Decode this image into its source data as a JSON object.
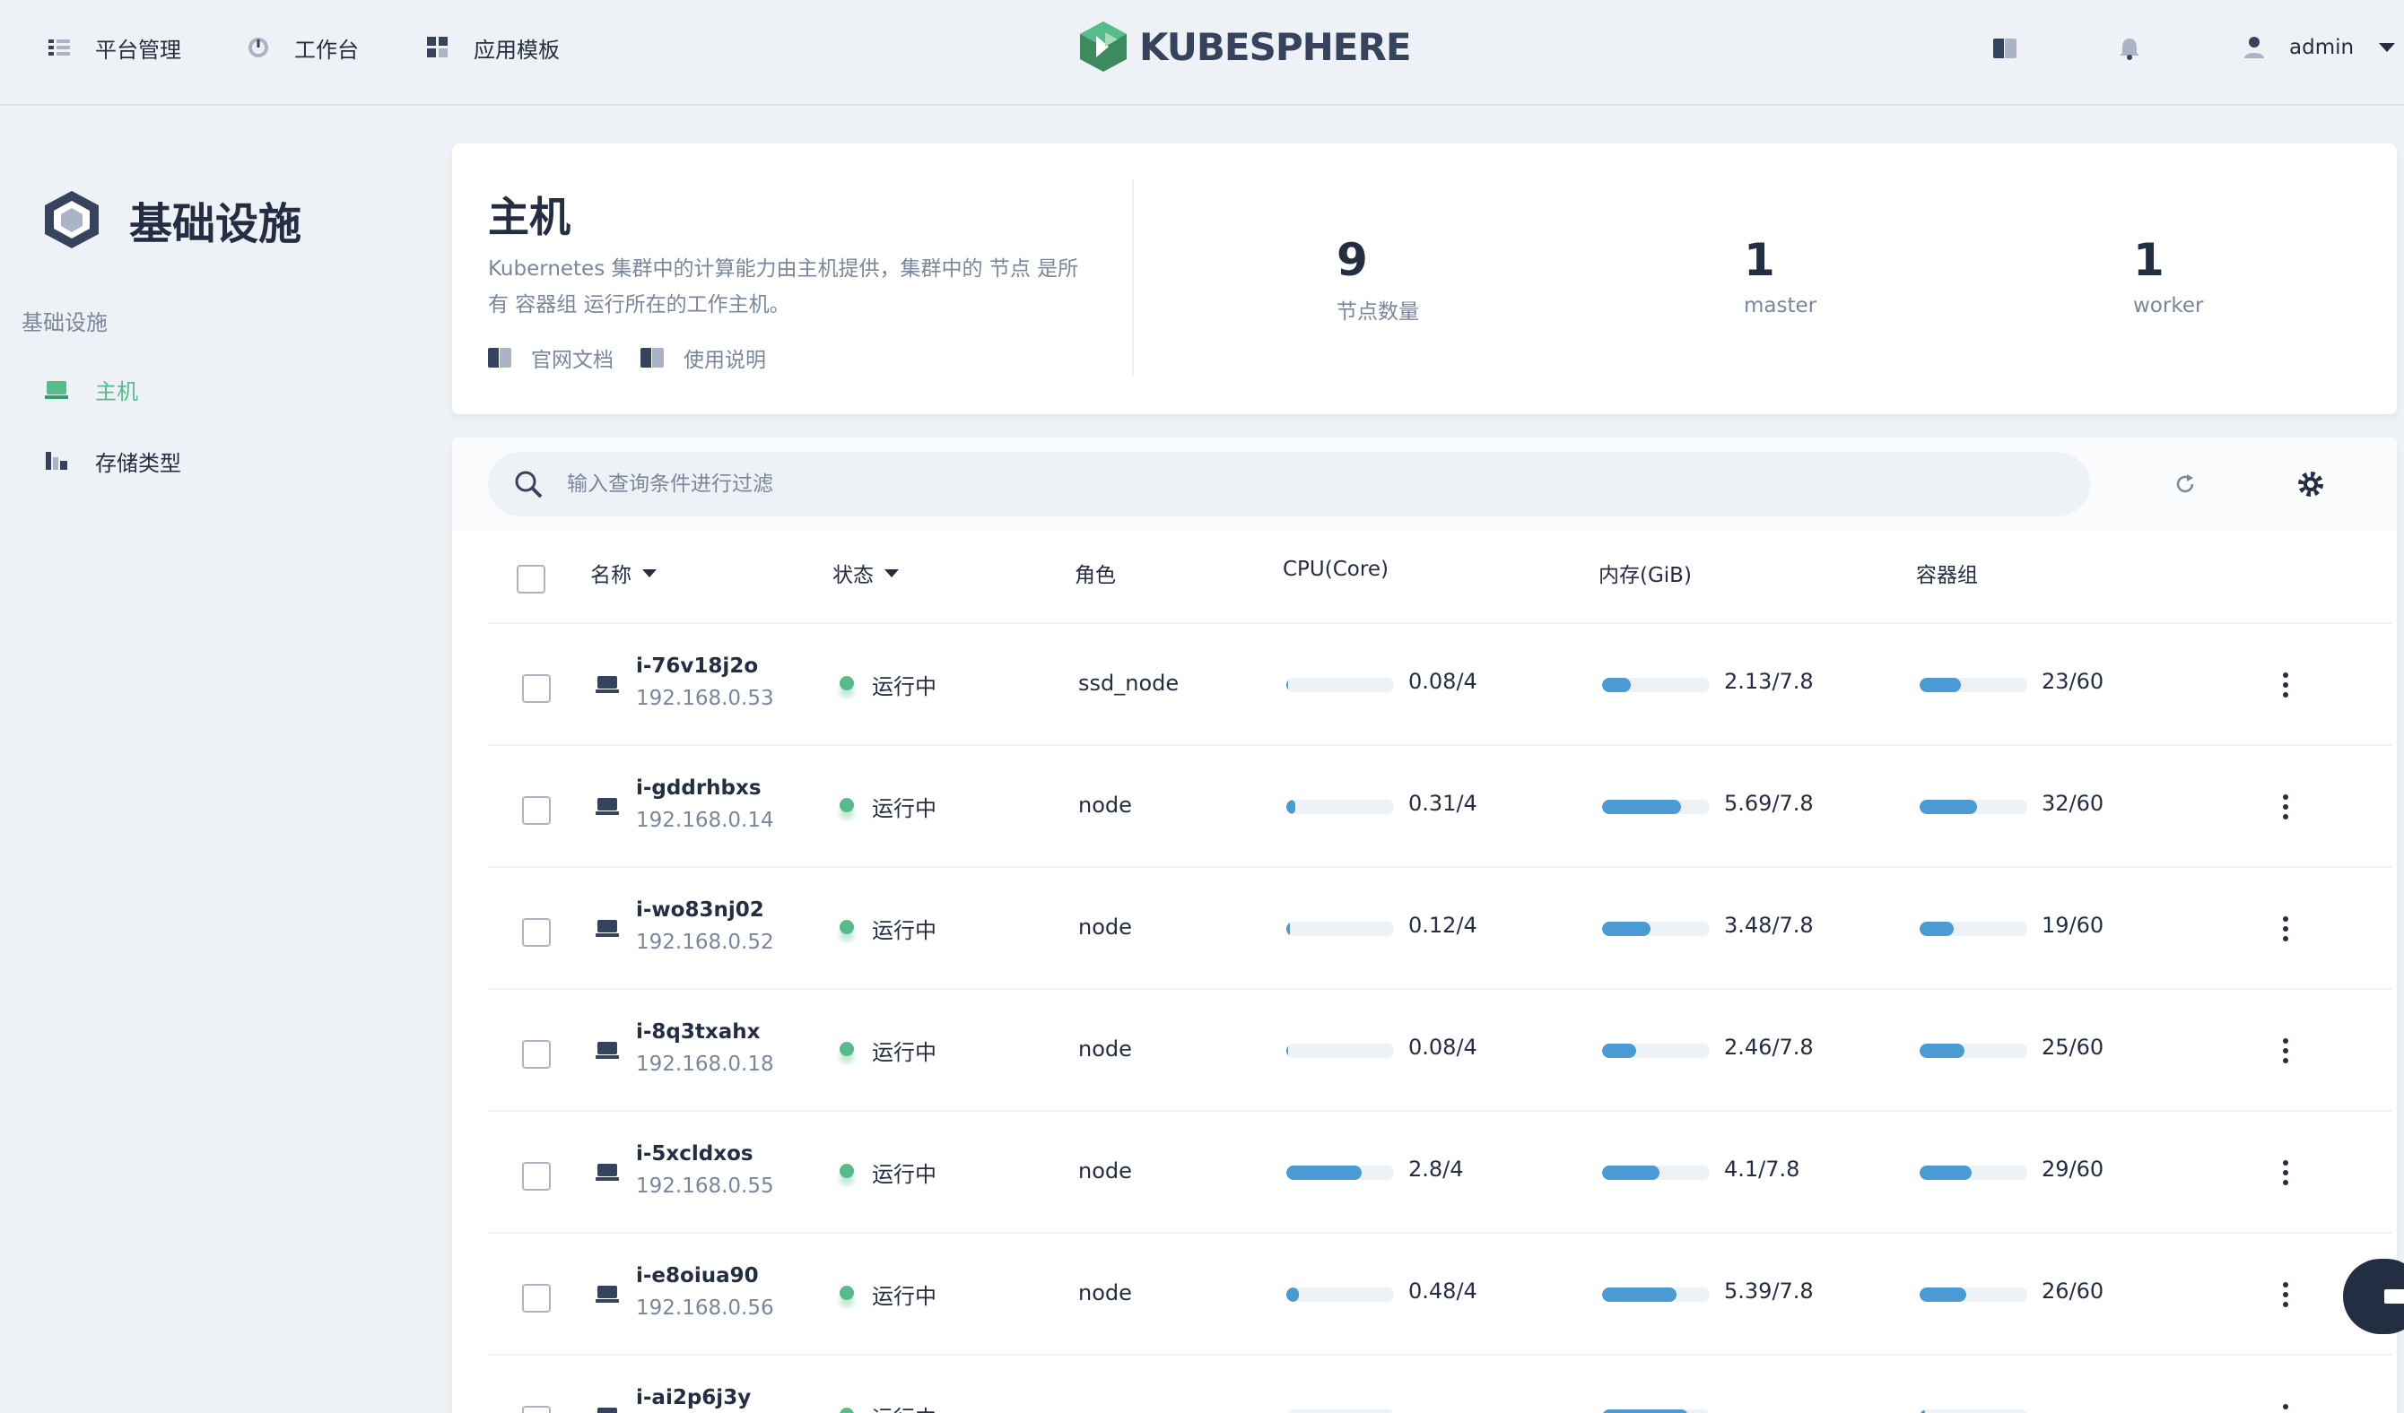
{
  "nav": {
    "platform_label": "平台管理",
    "workbench_label": "工作台",
    "templates_label": "应用模板"
  },
  "brand": {
    "logo_text": "KUBESPHERE"
  },
  "user": {
    "name": "admin"
  },
  "sidebar": {
    "title": "基础设施",
    "group_label": "基础设施",
    "items": [
      {
        "label": "主机",
        "active": true
      },
      {
        "label": "存储类型",
        "active": false
      }
    ]
  },
  "header": {
    "title": "主机",
    "description": "Kubernetes 集群中的计算能力由主机提供，集群中的 节点 是所有 容器组 运行所在的工作主机。",
    "links": [
      "官网文档",
      "使用说明"
    ],
    "stats": [
      {
        "value": "9",
        "label": "节点数量"
      },
      {
        "value": "1",
        "label": "master"
      },
      {
        "value": "1",
        "label": "worker"
      }
    ]
  },
  "search": {
    "placeholder": "输入查询条件进行过滤"
  },
  "table": {
    "columns": {
      "name": "名称",
      "status": "状态",
      "role": "角色",
      "cpu": "CPU(Core)",
      "memory": "内存(GiB)",
      "pods": "容器组"
    },
    "rows": [
      {
        "name": "i-76v18j2o",
        "ip": "192.168.0.53",
        "status": "运行中",
        "role": "ssd_node",
        "cpu": "0.08/4",
        "cpu_pct": 2,
        "mem": "2.13/7.8",
        "mem_pct": 27,
        "pods": "23/60",
        "pods_pct": 38
      },
      {
        "name": "i-gddrhbxs",
        "ip": "192.168.0.14",
        "status": "运行中",
        "role": "node",
        "cpu": "0.31/4",
        "cpu_pct": 8,
        "mem": "5.69/7.8",
        "mem_pct": 73,
        "pods": "32/60",
        "pods_pct": 53
      },
      {
        "name": "i-wo83nj02",
        "ip": "192.168.0.52",
        "status": "运行中",
        "role": "node",
        "cpu": "0.12/4",
        "cpu_pct": 3,
        "mem": "3.48/7.8",
        "mem_pct": 45,
        "pods": "19/60",
        "pods_pct": 32
      },
      {
        "name": "i-8q3txahx",
        "ip": "192.168.0.18",
        "status": "运行中",
        "role": "node",
        "cpu": "0.08/4",
        "cpu_pct": 2,
        "mem": "2.46/7.8",
        "mem_pct": 32,
        "pods": "25/60",
        "pods_pct": 42
      },
      {
        "name": "i-5xcldxos",
        "ip": "192.168.0.55",
        "status": "运行中",
        "role": "node",
        "cpu": "2.8/4",
        "cpu_pct": 70,
        "mem": "4.1/7.8",
        "mem_pct": 53,
        "pods": "29/60",
        "pods_pct": 48
      },
      {
        "name": "i-e8oiua90",
        "ip": "192.168.0.56",
        "status": "运行中",
        "role": "node",
        "cpu": "0.48/4",
        "cpu_pct": 12,
        "mem": "5.39/7.8",
        "mem_pct": 69,
        "pods": "26/60",
        "pods_pct": 43
      },
      {
        "name": "i-ai2p6j3y",
        "ip": "",
        "status": "运行中",
        "role": "",
        "cpu": "",
        "cpu_pct": 1,
        "mem": "",
        "mem_pct": 80,
        "pods": "",
        "pods_pct": 5
      }
    ]
  },
  "colors": {
    "accent": "#55bc8a",
    "bar": "#4a9ad4",
    "text": "#242e42",
    "muted": "#79879c"
  }
}
